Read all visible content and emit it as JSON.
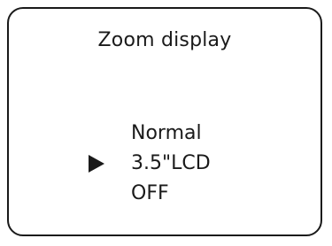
{
  "screen": {
    "title": "Zoom display"
  },
  "menu": {
    "items": [
      {
        "label": "Normal",
        "selected": false
      },
      {
        "label": "3.5\"LCD",
        "selected": true
      },
      {
        "label": "OFF",
        "selected": false
      }
    ],
    "cursor_icon": "triangle-right-icon"
  }
}
